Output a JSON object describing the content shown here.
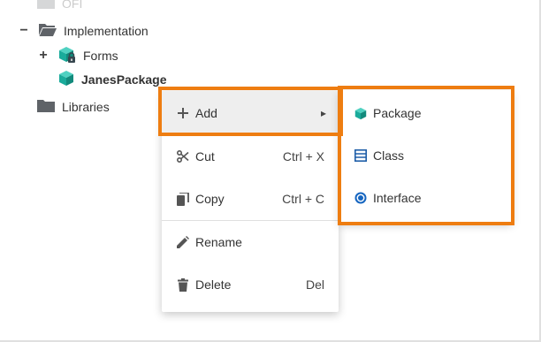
{
  "tree": {
    "top_faded_label": "OFI",
    "implementation": {
      "toggle": "−",
      "label": "Implementation"
    },
    "forms": {
      "toggle": "+",
      "label": "Forms"
    },
    "janes_package": {
      "label": "JanesPackage"
    },
    "libraries": {
      "label": "Libraries"
    }
  },
  "context_menu": {
    "add": {
      "label": "Add",
      "arrow": "▸"
    },
    "cut": {
      "label": "Cut",
      "shortcut": "Ctrl + X"
    },
    "copy": {
      "label": "Copy",
      "shortcut": "Ctrl + C"
    },
    "rename": {
      "label": "Rename"
    },
    "delete": {
      "label": "Delete",
      "shortcut": "Del"
    }
  },
  "submenu": {
    "package": {
      "label": "Package"
    },
    "class": {
      "label": "Class"
    },
    "interface": {
      "label": "Interface"
    }
  },
  "colors": {
    "highlight_orange": "#ee7d11",
    "package_teal": "#1aab9b",
    "class_blue": "#1e5ea8",
    "interface_blue": "#1565c0",
    "folder_grey": "#5f6368",
    "hover_grey": "#eeeeee"
  },
  "icons": {
    "folder_open": "folder-open-icon",
    "package_locked": "package-lock-icon",
    "package": "package-icon",
    "folder": "folder-icon",
    "plus": "plus-icon",
    "scissors": "scissors-icon",
    "copy": "copy-icon",
    "pencil": "pencil-icon",
    "trash": "trash-icon",
    "class": "class-icon",
    "interface": "interface-icon",
    "chevron_right": "chevron-right-icon"
  }
}
